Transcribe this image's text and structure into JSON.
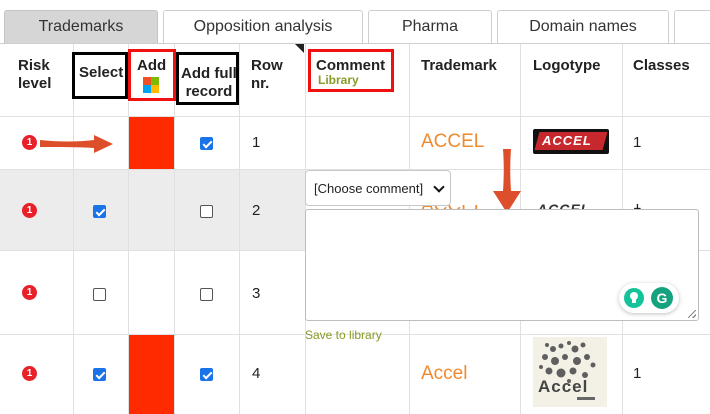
{
  "tabs": [
    {
      "label": "Trademarks",
      "active": true
    },
    {
      "label": "Opposition analysis",
      "active": false
    },
    {
      "label": "Pharma",
      "active": false
    },
    {
      "label": "Domain names",
      "active": false
    }
  ],
  "columns": {
    "risk": [
      "Risk",
      "level"
    ],
    "select": "Select",
    "add": "Add",
    "add_full": [
      "Add full",
      "record"
    ],
    "row": [
      "Row",
      "nr."
    ],
    "comment": "Comment",
    "comment_sub": "Library",
    "trademark": "Trademark",
    "logotype": "Logotype",
    "classes": "Classes"
  },
  "rows": [
    {
      "risk": "1",
      "select_checked": null,
      "add_highlight": true,
      "full_checked": true,
      "row": "1",
      "trademark": "ACCEL",
      "logo_text": "ACCEL",
      "classes": "1"
    },
    {
      "risk": "1",
      "select_checked": true,
      "add_highlight": false,
      "full_checked": false,
      "row": "2",
      "trademark": "ACCEL",
      "logo_text": "ACCEL",
      "classes": "1"
    },
    {
      "risk": "1",
      "select_checked": false,
      "add_highlight": false,
      "full_checked": false,
      "row": "3",
      "trademark": "",
      "logo_text": "",
      "classes": ""
    },
    {
      "risk": "1",
      "select_checked": true,
      "add_highlight": true,
      "full_checked": true,
      "row": "4",
      "trademark": "Accel",
      "logo_text": "Accel",
      "classes": "1"
    }
  ],
  "comment_popup": {
    "select_value": "[Choose comment]",
    "save_label": "Save to library"
  },
  "colors": {
    "accent_red": "#e8202a",
    "add_fill": "#ff2a00",
    "trademark_orange": "#ef8a2e",
    "checkbox_blue": "#1a73e8",
    "library_green": "#8a9a2a",
    "grammarly_green": "#15c39a"
  }
}
